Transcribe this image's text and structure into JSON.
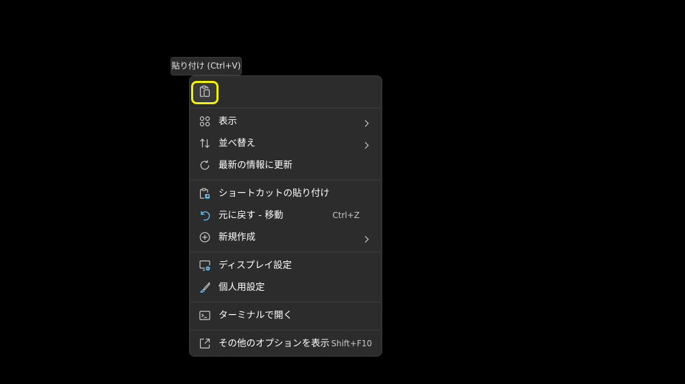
{
  "tooltip": {
    "text": "貼り付け (Ctrl+V)"
  },
  "quick_actions": [
    {
      "name": "paste",
      "icon": "clipboard-paste-icon",
      "highlighted": true,
      "highlight_color": "#f5f500"
    }
  ],
  "menu": {
    "groups": [
      [
        {
          "label": "表示",
          "icon": "view-grid-icon",
          "submenu": true
        },
        {
          "label": "並べ替え",
          "icon": "sort-arrows-icon",
          "submenu": true
        },
        {
          "label": "最新の情報に更新",
          "icon": "refresh-icon"
        }
      ],
      [
        {
          "label": "ショートカットの貼り付け",
          "icon": "paste-shortcut-icon"
        },
        {
          "label": "元に戻す - 移動",
          "icon": "undo-icon",
          "shortcut": "Ctrl+Z"
        },
        {
          "label": "新規作成",
          "icon": "new-plus-icon",
          "submenu": true
        }
      ],
      [
        {
          "label": "ディスプレイ設定",
          "icon": "display-settings-icon"
        },
        {
          "label": "個人用設定",
          "icon": "personalize-brush-icon"
        }
      ],
      [
        {
          "label": "ターミナルで開く",
          "icon": "terminal-icon"
        }
      ],
      [
        {
          "label": "その他のオプションを表示",
          "icon": "more-options-icon",
          "shortcut": "Shift+F10"
        }
      ]
    ]
  },
  "colors": {
    "background": "#000000",
    "menu_bg": "#2c2c2c",
    "text": "#ffffff",
    "icon": "#cfcfcf",
    "accent": "#60cdff",
    "highlight": "#f5f500"
  }
}
